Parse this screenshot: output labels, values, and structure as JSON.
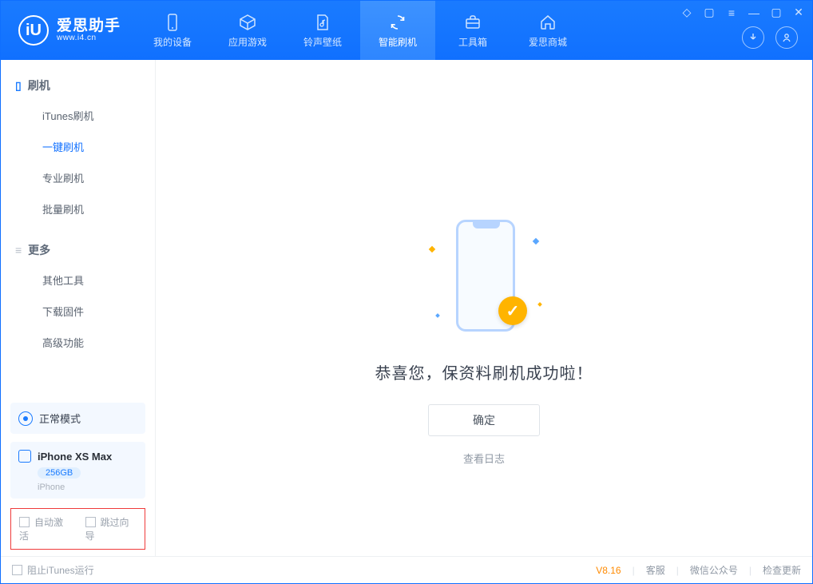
{
  "app": {
    "name_cn": "爱思助手",
    "site": "www.i4.cn",
    "logo_letter": "iU"
  },
  "nav": {
    "items": [
      {
        "label": "我的设备",
        "icon": "device"
      },
      {
        "label": "应用游戏",
        "icon": "cube"
      },
      {
        "label": "铃声壁纸",
        "icon": "music"
      },
      {
        "label": "智能刷机",
        "icon": "sync",
        "active": true
      },
      {
        "label": "工具箱",
        "icon": "toolbox"
      },
      {
        "label": "爱思商城",
        "icon": "home"
      }
    ]
  },
  "win_controls_top": [
    "shirt",
    "page",
    "menu",
    "min",
    "max",
    "close"
  ],
  "sidebar": {
    "section1": {
      "title": "刷机",
      "items": [
        "iTunes刷机",
        "一键刷机",
        "专业刷机",
        "批量刷机"
      ],
      "active_index": 1
    },
    "section2": {
      "title": "更多",
      "items": [
        "其他工具",
        "下载固件",
        "高级功能"
      ]
    },
    "status": {
      "label": "正常模式"
    },
    "device": {
      "name": "iPhone XS Max",
      "storage": "256GB",
      "type": "iPhone"
    },
    "checks": {
      "auto_activate": "自动激活",
      "skip_guide": "跳过向导"
    }
  },
  "main": {
    "success_msg": "恭喜您，保资料刷机成功啦！",
    "ok_btn": "确定",
    "log_link": "查看日志"
  },
  "statusbar": {
    "block_itunes": "阻止iTunes运行",
    "version": "V8.16",
    "links": [
      "客服",
      "微信公众号",
      "检查更新"
    ]
  }
}
